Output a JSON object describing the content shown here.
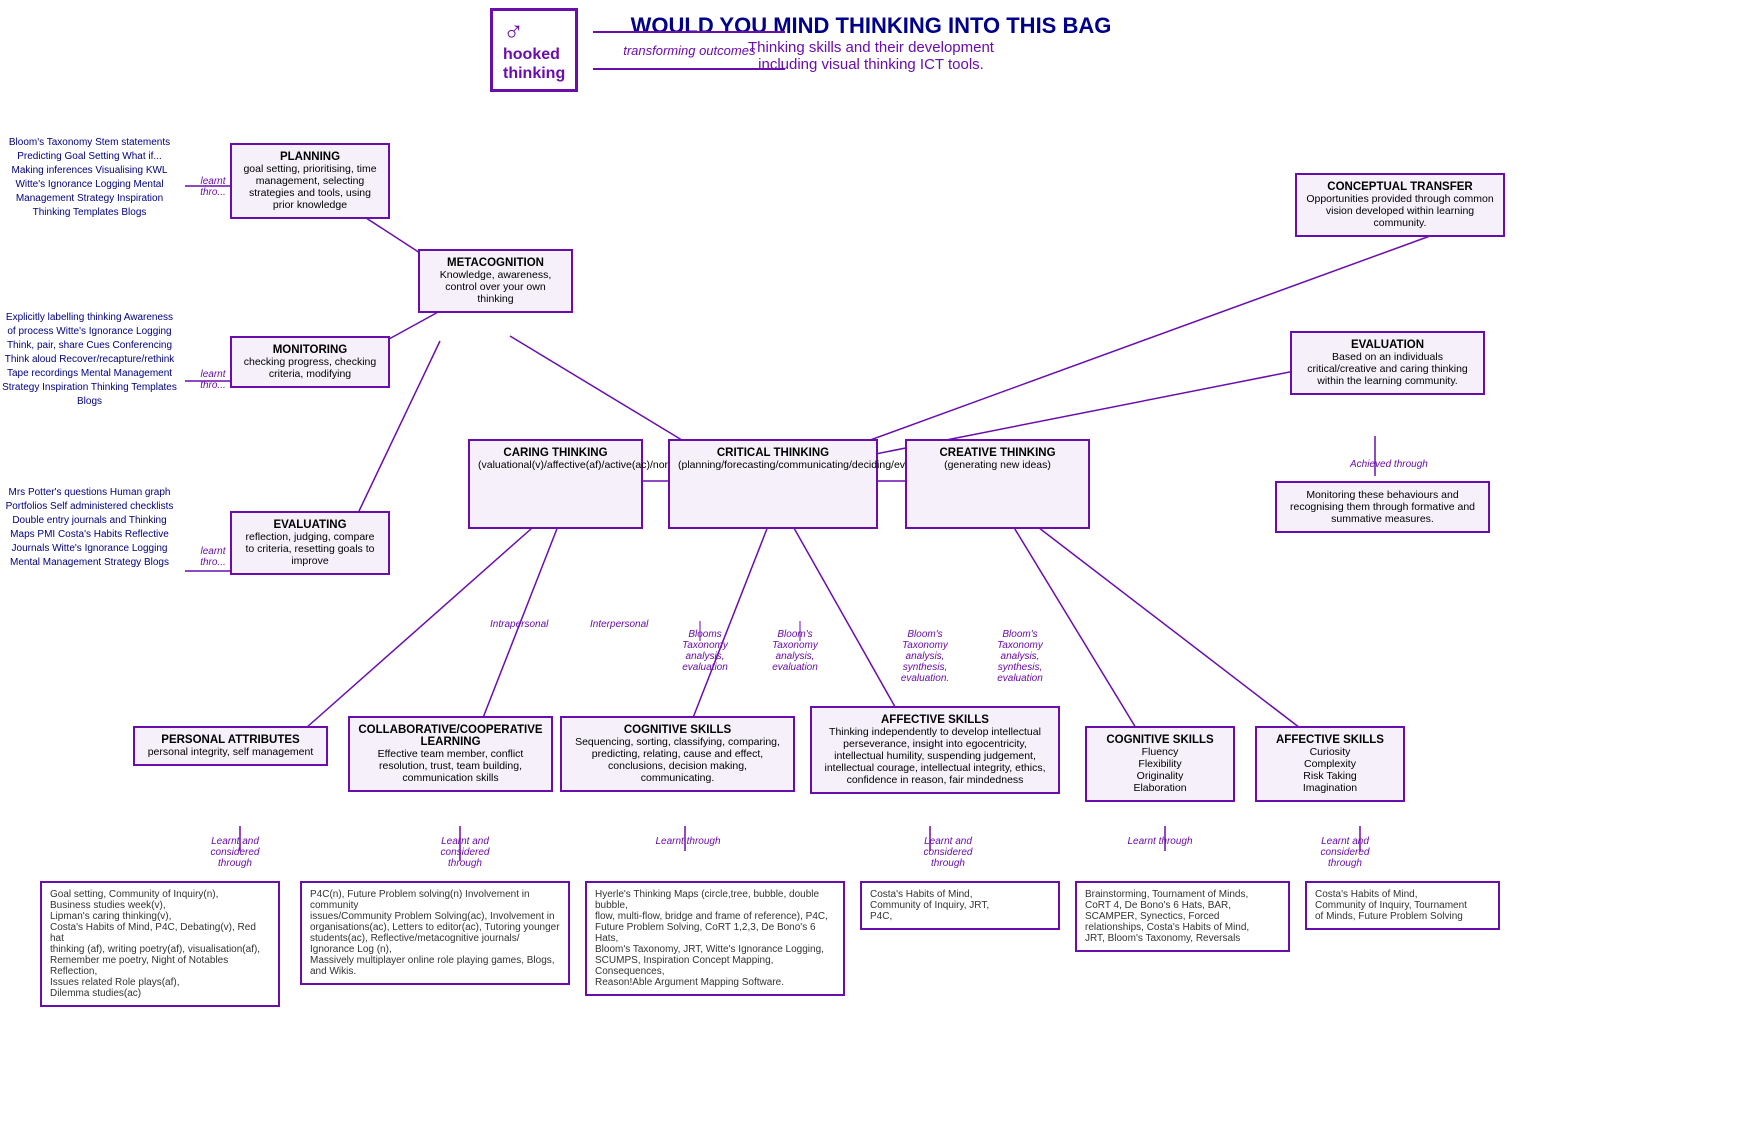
{
  "header": {
    "logo_line1": "hooked",
    "logo_line2": "thinking",
    "logo_tagline": "transforming outcomes",
    "main_title": "WOULD YOU MIND THINKING INTO THIS BAG",
    "sub_title": "Thinking skills and their development\nincluding visual thinking ICT tools."
  },
  "boxes": {
    "planning": {
      "title": "PLANNING",
      "body": "goal setting, prioritising, time management, selecting strategies and tools, using prior knowledge"
    },
    "metacognition": {
      "title": "METACOGNITION",
      "body": "Knowledge, awareness, control over your own thinking"
    },
    "monitoring": {
      "title": "MONITORING",
      "body": "checking progress, checking criteria, modifying"
    },
    "evaluating": {
      "title": "EVALUATING",
      "body": "reflection, judging, compare to criteria, resetting goals to improve"
    },
    "conceptual_transfer": {
      "title": "CONCEPTUAL  TRANSFER",
      "body": "Opportunities provided through common vision developed within learning community."
    },
    "evaluation_right": {
      "title": "EVALUATION",
      "body": "Based on an individuals critical/creative and caring thinking within the learning community."
    },
    "monitoring_right": {
      "body": "Monitoring these behaviours and recognising them through formative and summative measures."
    },
    "caring_thinking": {
      "title": "CARING THINKING",
      "body": "(valuational(v)/affective(af)/active(ac)/normative(n))"
    },
    "critical_thinking": {
      "title": "CRITICAL THINKING",
      "body": "(planning/forecasting/communicating/deciding/evaluating)"
    },
    "creative_thinking": {
      "title": "CREATIVE THINKING",
      "body": "(generating new ideas)"
    },
    "personal_attributes": {
      "title": "PERSONAL ATTRIBUTES",
      "body": "personal integrity, self management"
    },
    "collaborative": {
      "title": "COLLABORATIVE/COOPERATIVE LEARNING",
      "body": "Effective team member, conflict resolution, trust, team building, communication skills"
    },
    "cognitive_skills_mid": {
      "title": "COGNITIVE SKILLS",
      "body": "Sequencing, sorting, classifying, comparing, predicting, relating, cause and effect, conclusions, decision making, communicating."
    },
    "affective_skills_mid": {
      "title": "AFFECTIVE SKILLS",
      "body": "Thinking independently to develop intellectual perseverance, insight into egocentricity, intellectual humility, suspending judgement, intellectual courage, intellectual integrity, ethics, confidence in reason, fair mindedness"
    },
    "cognitive_skills_right": {
      "title": "COGNITIVE SKILLS",
      "body": "Fluency\nFlexibility\nOriginality\nElaboration"
    },
    "affective_skills_right": {
      "title": "AFFECTIVE SKILLS",
      "body": "Curiosity\nComplexity\nRisk Taking\nImagination"
    }
  },
  "left_texts": {
    "top": "Bloom's Taxonomy\nStem statements\nPredicting\nGoal Setting\nWhat if...\nMaking inferences\nVisualising\nKWL\nWitte's Ignorance Logging\nMental Management Strategy\nInspiration Thinking Templates\nBlogs",
    "mid_top": "Explicitly labelling thinking\nAwareness of process\nWitte's Ignorance Logging\nThink, pair, share\nCues\nConferencing\nThink aloud\nRecover/recapture/rethink\nTape recordings\nMental Management Strategy\nInspiration Thinking Templates\nBlogs",
    "mid_bot": "Mrs Potter's questions\nHuman graph\nPortfolios\nSelf administered checklists\nDouble entry journals and\nThinking Maps\nPMI\nCosta's Habits\nReflective Journals\nWitte's Ignorance Logging\nMental Management Strategy\nBlogs"
  },
  "bottom_texts": {
    "personal": "Goal setting, Community of Inquiry(n),\nBusiness studies week(v),\nLipman's caring thinking(v),\nCosta's Habits of Mind, P4C, Debating(v), Red hat\nthinking (af), writing poetry(af), visualisation(af),\nRemember me poetry, Night of Notables Reflection,\nIssues related Role plays(af),\nDilemma studies(ac)",
    "collaborative": "P4C(n), Future Problem solving(n) Involvement in community\nissues/Community Problem Solving(ac), Involvement in\norganisations(ac), Letters to editor(ac), Tutoring younger\nstudents(ac), Reflective/metacognitive journals/ Ignorance Log (n),\nMassively multiplayer online role playing games, Blogs, and Wikis.",
    "cognitive_mid": "Hyerle's Thinking Maps (circle,tree, bubble, double bubble,\nflow, multi-flow, bridge and frame of reference), P4C,\nFuture Problem Solving, CoRT 1,2,3, De Bono's 6 Hats,\nBloom's Taxonomy, JRT, Witte's Ignorance Logging,\nSCUMPS, Inspiration Concept Mapping, Consequences,\nReason!Able Argument Mapping Software.",
    "affective_mid": "Costa's Habits of Mind,\nCommunity of Inquiry, JRT,\nP4C,",
    "cognitive_right": "Brainstorming, Tournament of Minds,\nCoRT 4, De Bono's 6 Hats, BAR,\nSCAMPER, Synectics, Forced\nrelationships, Costa's Habits of Mind,\nJRT, Bloom's Taxonomy, Reversals",
    "affective_right": "Costa's Habits of Mind,\nCommunity of Inquiry, Tournament\nof Minds, Future Problem Solving"
  },
  "labels": {
    "learnt_through_1": "learnt thro...",
    "learnt_through_2": "learnt thro...",
    "learnt_through_3": "learnt thro...",
    "achieved_through": "Achieved through",
    "intrapersonal": "Intrapersonal",
    "interpersonal": "Interpersonal",
    "blooms_1": "Blooms\nTaxonomy\nanalysis,\nevaluation",
    "blooms_2": "Bloom's\nTaxonomy\nanalysis,\nevaluation",
    "blooms_3": "Bloom's\nTaxonomy\nanalysis,\nsynthesis,\nevaluation.",
    "blooms_4": "Bloom's\nTaxonomy\nanalysis,\nsynthesis,\nevaluation",
    "learnt_considered_1": "Learnt and\nconsidered\nthrough",
    "learnt_considered_2": "Learnt and\nconsidered\nthrough",
    "learnt_through_bot1": "Learnt through",
    "learnt_considered_3": "Learnt and\nconsidered\nthrough",
    "learnt_through_bot2": "Learnt through",
    "learnt_considered_4": "Learnt and\nconsidered\nthrough"
  }
}
